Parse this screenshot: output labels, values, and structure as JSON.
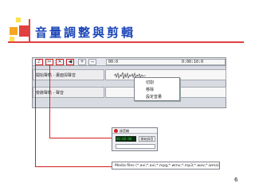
{
  "slide": {
    "title": "音量調整與剪輯",
    "page_number": "6"
  },
  "editor": {
    "ruler": {
      "start": "00:0",
      "end": "0:00:10:0"
    },
    "tracks": [
      {
        "label": "開始聲軌 - 畫面與聲音"
      },
      {
        "label": "旁錄聲軌 - 聲音"
      }
    ]
  },
  "context_menu": {
    "items": [
      {
        "label": "切割"
      },
      {
        "label": "移除"
      },
      {
        "label": "設定音量"
      }
    ]
  },
  "record_dialog": {
    "title": "錄音機",
    "timer": "00:00:00",
    "start_button": "開始錄音"
  },
  "file_types": "Media files (*.avi;*.avi;*.mpg;*.wmv;*.mp3;*.wav;*.wma)",
  "colors": {
    "title": "#1a44b8",
    "accent_red": "#d42020",
    "deco_orange": "#f5a623",
    "deco_yellow": "#ffe14d"
  }
}
